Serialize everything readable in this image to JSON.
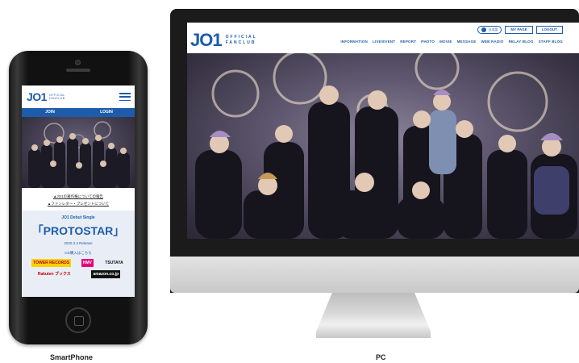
{
  "smartphone": {
    "logo_main": "JO1",
    "logo_sub_1": "OFFICIAL",
    "logo_sub_2": "FANCLUB",
    "nav": [
      "JOIN",
      "LOGIN"
    ],
    "links": [
      "▲JO1の著作権についての報告",
      "▲ファンレター・プレゼントについて"
    ],
    "promo": {
      "subtitle": "JO1 Debut Single",
      "title": "「PROTOSTAR」",
      "date": "2020.3.4 Release",
      "cd_label": "CD購入はこちら",
      "shops_row1": [
        "TOWER RECORDS",
        "HMV",
        "TSUTAYA"
      ],
      "shops_row2": [
        "Rakuten ブックス",
        "amazon.co.jp"
      ]
    },
    "caption": "SmartPhone"
  },
  "pc": {
    "logo_main": "JO1",
    "logo_sub_1": "OFFICIAL",
    "logo_sub_2": "FANCLUB",
    "lang_label": "日本語",
    "mypage_label": "MY PAGE",
    "logout_label": "LOGOUT",
    "nav": [
      "INFORMATION",
      "LIVE/EVENT",
      "REPORT",
      "PHOTO",
      "MOVIE",
      "MESSAGE",
      "WEB RADIO",
      "RELAY BLOG",
      "STAFF BLOG"
    ],
    "caption": "PC"
  },
  "colors": {
    "brand": "#1d5cab",
    "promo_bg": "#e9eef6"
  }
}
